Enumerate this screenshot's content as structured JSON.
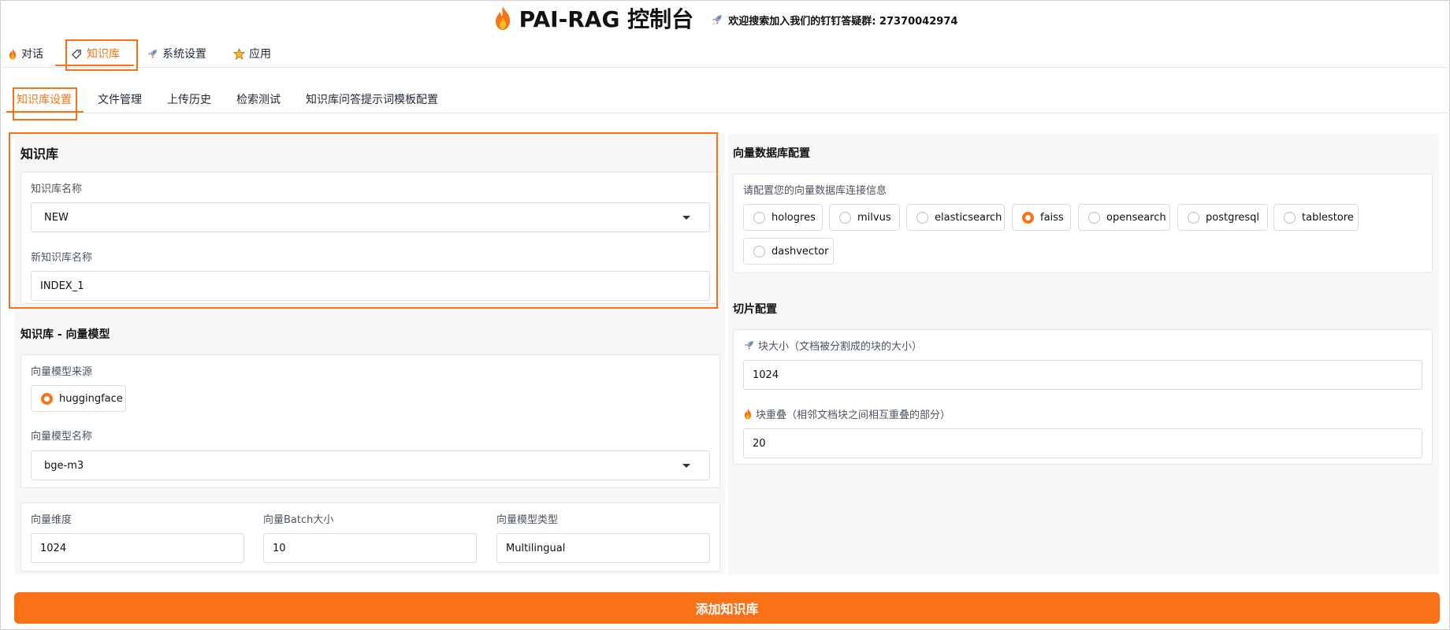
{
  "header": {
    "title": "PAI-RAG 控制台",
    "notice": "欢迎搜索加入我们的钉钉答疑群: 27370042974"
  },
  "top_tabs": [
    {
      "label": "对话",
      "icon": "fire-icon"
    },
    {
      "label": "知识库",
      "icon": "tag-icon",
      "active": true
    },
    {
      "label": "系统设置",
      "icon": "rocket-icon"
    },
    {
      "label": "应用",
      "icon": "star-icon"
    }
  ],
  "sub_tabs": [
    {
      "label": "知识库设置",
      "active": true
    },
    {
      "label": "文件管理"
    },
    {
      "label": "上传历史"
    },
    {
      "label": "检索测试"
    },
    {
      "label": "知识库问答提示词模板配置"
    }
  ],
  "knowledge_base": {
    "title": "知识库",
    "name_label": "知识库名称",
    "name_value": "NEW",
    "new_name_label": "新知识库名称",
    "new_name_value": "INDEX_1"
  },
  "embedding": {
    "title": "知识库 - 向量模型",
    "source_label": "向量模型来源",
    "source_option": "huggingface",
    "model_name_label": "向量模型名称",
    "model_name_value": "bge-m3",
    "dim_label": "向量维度",
    "dim_value": "1024",
    "batch_label": "向量Batch大小",
    "batch_value": "10",
    "type_label": "向量模型类型",
    "type_value": "Multilingual"
  },
  "vector_db": {
    "title": "向量数据库配置",
    "hint": "请配置您的向量数据库连接信息",
    "options": [
      "hologres",
      "milvus",
      "elasticsearch",
      "faiss",
      "opensearch",
      "postgresql",
      "tablestore",
      "dashvector"
    ],
    "selected": "faiss"
  },
  "chunk": {
    "title": "切片配置",
    "size_label": "块大小（文档被分割成的块的大小）",
    "size_value": "1024",
    "overlap_label": "块重叠（相邻文档块之间相互重叠的部分）",
    "overlap_value": "20"
  },
  "actions": {
    "add_button": "添加知识库"
  },
  "colors": {
    "accent": "#f97316"
  }
}
